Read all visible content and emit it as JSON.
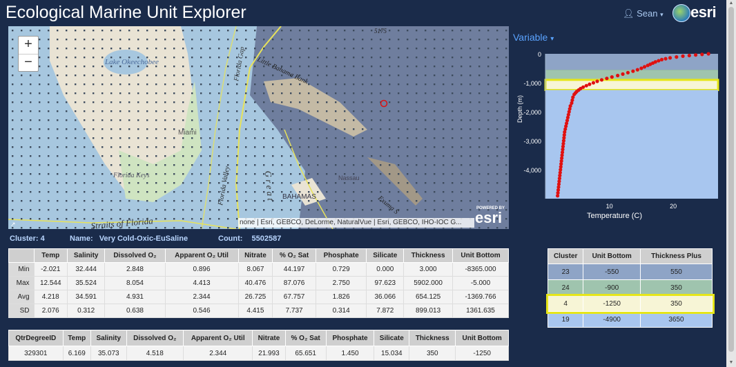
{
  "app": {
    "title": "Ecological Marine Unit Explorer",
    "user": "Sean",
    "logo": "esri"
  },
  "map": {
    "attribution": "none | Esri, GEBCO, DeLorme, NaturalVue | Esri, GEBCO, IHO-IOC G...",
    "zoom_in": "+",
    "zoom_out": "−",
    "powered_by": "POWERED BY",
    "esri_logo": "esri",
    "labels": {
      "lake": "Lake Okeechobee",
      "miami": "Miami",
      "florida_keys": "Florida\nKeys",
      "florida_gap": "Florida Gap",
      "bahama_bank": "Little Bahama Bank",
      "florida_valley": "Florida Valley",
      "great": "G r e a t",
      "bahamas": "BAHAMAS",
      "nassau": "Nassau",
      "straits": "Straits of Florida",
      "exuma": "Exuma S",
      "depth": "5175"
    }
  },
  "info": {
    "cluster_label": "Cluster:",
    "cluster_value": "4",
    "name_label": "Name:",
    "name_value": "Very Cold-Oxic-EuSaline",
    "count_label": "Count:",
    "count_value": "5502587"
  },
  "stats": {
    "headers": [
      "",
      "Temp",
      "Salinity",
      "Dissolved O₂",
      "Apparent O₂ Util",
      "Nitrate",
      "% O₂ Sat",
      "Phosphate",
      "Silicate",
      "Thickness",
      "Unit Bottom"
    ],
    "rows": [
      [
        "Min",
        "-2.021",
        "32.444",
        "2.848",
        "0.896",
        "8.067",
        "44.197",
        "0.729",
        "0.000",
        "3.000",
        "-8365.000"
      ],
      [
        "Max",
        "12.544",
        "35.524",
        "8.054",
        "4.413",
        "40.476",
        "87.076",
        "2.750",
        "97.623",
        "5902.000",
        "-5.000"
      ],
      [
        "Avg",
        "4.218",
        "34.591",
        "4.931",
        "2.344",
        "26.725",
        "67.757",
        "1.826",
        "36.066",
        "654.125",
        "-1369.766"
      ],
      [
        "SD",
        "2.076",
        "0.312",
        "0.638",
        "0.546",
        "4.415",
        "7.737",
        "0.314",
        "7.872",
        "899.013",
        "1361.635"
      ]
    ]
  },
  "point": {
    "headers": [
      "QtrDegreeID",
      "Temp",
      "Salinity",
      "Dissolved O₂",
      "Apparent O₂ Util",
      "Nitrate",
      "% O₂ Sat",
      "Phosphate",
      "Silicate",
      "Thickness",
      "Unit Bottom"
    ],
    "row": [
      "329301",
      "6.169",
      "35.073",
      "4.518",
      "2.344",
      "21.993",
      "65.651",
      "1.450",
      "15.034",
      "350",
      "-1250"
    ]
  },
  "clusters": {
    "headers": [
      "Cluster",
      "Unit Bottom",
      "Thickness Plus"
    ],
    "rows": [
      {
        "cells": [
          "23",
          "-550",
          "550"
        ],
        "color": "#8ea4c6"
      },
      {
        "cells": [
          "24",
          "-900",
          "350"
        ],
        "color": "#9fc4ae"
      },
      {
        "cells": [
          "4",
          "-1250",
          "350"
        ],
        "color": "#f7f5d6",
        "selected": true
      },
      {
        "cells": [
          "19",
          "-4900",
          "3650"
        ],
        "color": "#a8c6ef"
      }
    ]
  },
  "variable_menu": {
    "label": "Variable"
  },
  "chart_data": {
    "type": "scatter",
    "xlabel": "Temperature (C)",
    "ylabel": "Depth (m)",
    "xlim": [
      0,
      27
    ],
    "ylim": [
      -5000,
      0
    ],
    "xticks": [
      {
        "v": 10,
        "t": "10"
      },
      {
        "v": 20,
        "t": "20"
      }
    ],
    "yticks": [
      {
        "v": 0,
        "t": "0"
      },
      {
        "v": -1000,
        "t": "-1,000"
      },
      {
        "v": -2000,
        "t": "-2,000"
      },
      {
        "v": -3000,
        "t": "-3,000"
      },
      {
        "v": -4000,
        "t": "-4,000"
      }
    ],
    "bands": [
      {
        "from": 0,
        "to": -550,
        "color": "#8ea4c6"
      },
      {
        "from": -550,
        "to": -900,
        "color": "#9fc4ae"
      },
      {
        "from": -900,
        "to": -1250,
        "color": "#f7f5d6",
        "selected": true
      },
      {
        "from": -1250,
        "to": -5000,
        "color": "#a8c6ef"
      }
    ],
    "points": [
      [
        25.5,
        0
      ],
      [
        24.5,
        -20
      ],
      [
        23.5,
        -40
      ],
      [
        22.5,
        -60
      ],
      [
        21.5,
        -80
      ],
      [
        20.5,
        -110
      ],
      [
        19.5,
        -140
      ],
      [
        18.8,
        -170
      ],
      [
        18.2,
        -200
      ],
      [
        17.7,
        -240
      ],
      [
        17.2,
        -280
      ],
      [
        16.8,
        -320
      ],
      [
        16.4,
        -360
      ],
      [
        16.0,
        -400
      ],
      [
        15.5,
        -450
      ],
      [
        15.0,
        -500
      ],
      [
        14.4,
        -550
      ],
      [
        13.7,
        -600
      ],
      [
        12.9,
        -650
      ],
      [
        12.1,
        -700
      ],
      [
        11.3,
        -750
      ],
      [
        10.4,
        -800
      ],
      [
        9.6,
        -850
      ],
      [
        8.8,
        -900
      ],
      [
        8.1,
        -950
      ],
      [
        7.5,
        -1000
      ],
      [
        6.9,
        -1050
      ],
      [
        6.4,
        -1100
      ],
      [
        5.9,
        -1150
      ],
      [
        5.5,
        -1200
      ],
      [
        5.2,
        -1250
      ],
      [
        4.9,
        -1300
      ],
      [
        4.7,
        -1350
      ],
      [
        4.5,
        -1400
      ],
      [
        4.3,
        -1500
      ],
      [
        4.2,
        -1600
      ],
      [
        4.1,
        -1700
      ],
      [
        3.9,
        -1800
      ],
      [
        3.8,
        -1900
      ],
      [
        3.7,
        -2000
      ],
      [
        3.6,
        -2100
      ],
      [
        3.5,
        -2200
      ],
      [
        3.4,
        -2300
      ],
      [
        3.3,
        -2400
      ],
      [
        3.2,
        -2500
      ],
      [
        3.1,
        -2600
      ],
      [
        3.0,
        -2700
      ],
      [
        2.95,
        -2800
      ],
      [
        2.9,
        -2900
      ],
      [
        2.85,
        -3000
      ],
      [
        2.8,
        -3100
      ],
      [
        2.75,
        -3200
      ],
      [
        2.7,
        -3300
      ],
      [
        2.65,
        -3400
      ],
      [
        2.6,
        -3500
      ],
      [
        2.55,
        -3600
      ],
      [
        2.5,
        -3700
      ],
      [
        2.45,
        -3800
      ],
      [
        2.4,
        -3900
      ],
      [
        2.35,
        -4000
      ],
      [
        2.3,
        -4100
      ],
      [
        2.25,
        -4200
      ],
      [
        2.2,
        -4300
      ],
      [
        2.15,
        -4400
      ],
      [
        2.1,
        -4500
      ],
      [
        2.05,
        -4600
      ],
      [
        2.0,
        -4700
      ],
      [
        1.95,
        -4800
      ],
      [
        1.9,
        -4900
      ]
    ],
    "colors": {
      "point": "#e01010",
      "selected_border": "#e6e619"
    }
  }
}
